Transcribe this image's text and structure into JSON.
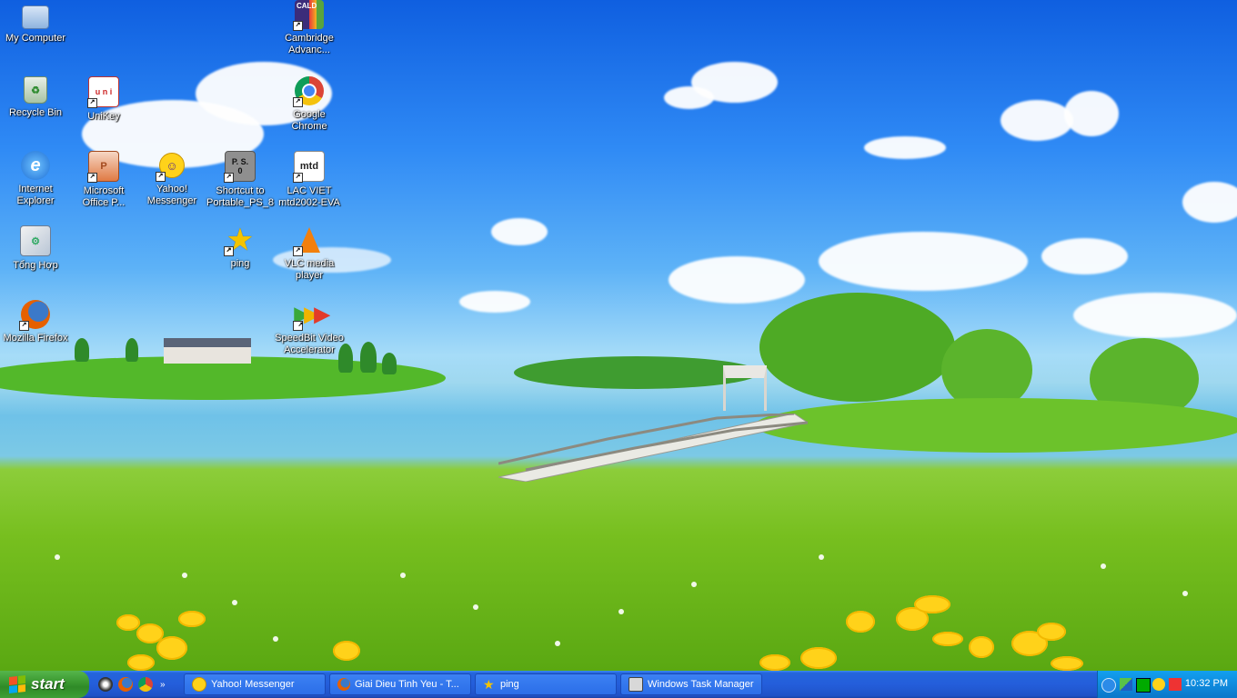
{
  "desktop": {
    "icons": [
      {
        "label": "My Computer"
      },
      {
        "label": "Cambridge Advanc..."
      },
      {
        "label": "Recycle Bin"
      },
      {
        "label": "UniKey"
      },
      {
        "label": "Google Chrome"
      },
      {
        "label": "Internet Explorer"
      },
      {
        "label": "Microsoft Office P..."
      },
      {
        "label": "Yahoo! Messenger"
      },
      {
        "label": "Shortcut to Portable_PS_8"
      },
      {
        "label": "LAC VIET mtd2002-EVA"
      },
      {
        "label": "Tổng Hợp"
      },
      {
        "label": "ping"
      },
      {
        "label": "VLC media player"
      },
      {
        "label": "Mozilla Firefox"
      },
      {
        "label": "SpeedBit Video Accelerator"
      }
    ],
    "icon_glyphs": {
      "cambridge": "CALD",
      "portable_ps": "P. S.\n0",
      "lacviet": "mtd",
      "unikey": "u n i"
    }
  },
  "taskbar": {
    "start_label": "start",
    "quicklaunch_more": "»",
    "tasks": [
      {
        "label": "Yahoo! Messenger"
      },
      {
        "label": "Giai Dieu Tinh Yeu - T..."
      },
      {
        "label": "ping"
      },
      {
        "label": "Windows Task Manager"
      }
    ],
    "clock": "10:32 PM"
  },
  "colors": {
    "taskbar_blue": "#245edb",
    "start_green": "#3c9a32",
    "tray_blue": "#0f8bde"
  }
}
